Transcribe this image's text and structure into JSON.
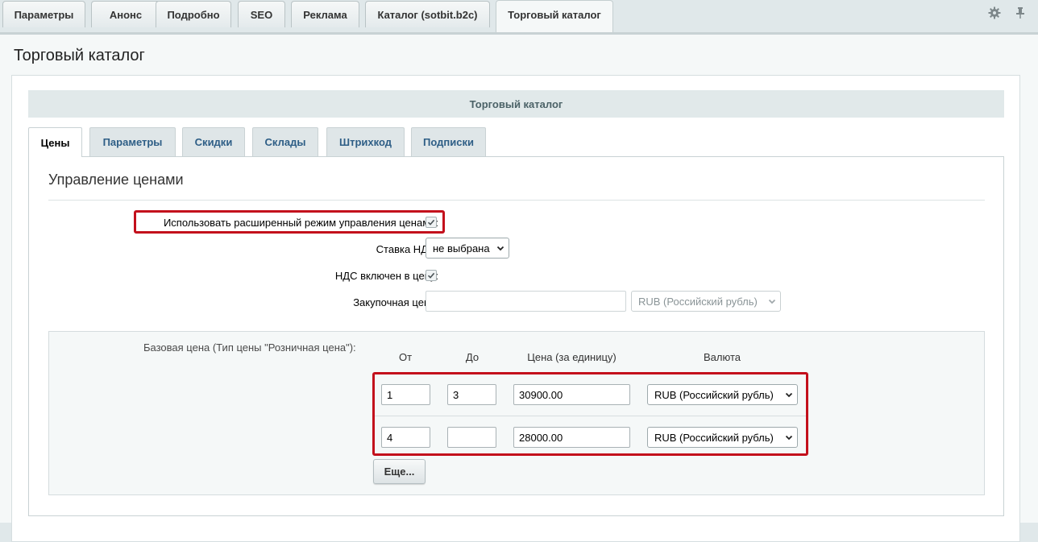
{
  "top_tabs": [
    "Параметры",
    "Анонс",
    "Подробно",
    "SEO",
    "Реклама",
    "Каталог (sotbit.b2c)",
    "Торговый каталог"
  ],
  "active_top_tab": "Торговый каталог",
  "icons": {
    "settings": "gear-icon",
    "pin": "pin-icon"
  },
  "page_title": "Торговый каталог",
  "section_header": "Торговый каталог",
  "inner_tabs": [
    "Цены",
    "Параметры",
    "Скидки",
    "Склады",
    "Штрихкод",
    "Подписки"
  ],
  "active_inner_tab": "Цены",
  "price_management": {
    "title": "Управление ценами",
    "extended_mode_label": "Использовать расширенный режим управления ценами:",
    "extended_mode_checked": true,
    "vat_rate_label": "Ставка НДС:",
    "vat_rate_value": "не выбрана",
    "vat_included_label": "НДС включен в цену:",
    "vat_included_checked": true,
    "purchase_price_label": "Закупочная цена:",
    "purchase_price_value": "",
    "purchase_currency": "RUB (Российский рубль)"
  },
  "base_price": {
    "label": "Базовая цена (Тип цены \"Розничная цена\"):",
    "columns": [
      "От",
      "До",
      "Цена (за единицу)",
      "Валюта"
    ],
    "rows": [
      {
        "from": "1",
        "to": "3",
        "price": "30900.00",
        "currency": "RUB (Российский рубль)"
      },
      {
        "from": "4",
        "to": "",
        "price": "28000.00",
        "currency": "RUB (Российский рубль)"
      }
    ],
    "more_button": "Еще..."
  },
  "colors": {
    "highlight": "#c3101c",
    "tab_link": "#2e5e86",
    "header_bg": "#e1e9ea"
  }
}
